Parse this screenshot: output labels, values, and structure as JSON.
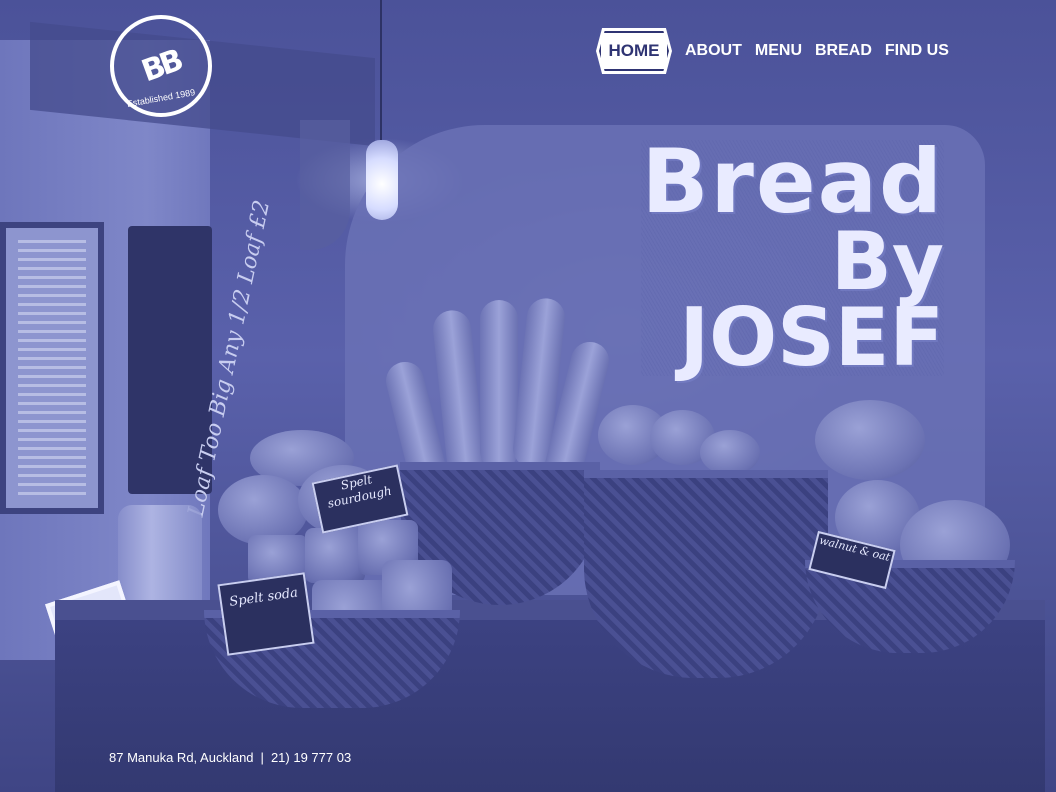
{
  "logo": {
    "mark": "BB",
    "ring_text": "Established 1989"
  },
  "nav": {
    "items": [
      {
        "label": "HOME"
      },
      {
        "label": "ABOUT"
      },
      {
        "label": "MENU"
      },
      {
        "label": "BREAD"
      },
      {
        "label": "FIND US"
      }
    ]
  },
  "hero": {
    "title_line1": "Bread",
    "title_line2": "By",
    "title_line3": "JOSEF",
    "signs": {
      "spelt_sourdough": "Spelt sourdough",
      "spelt_soda": "Spelt soda",
      "walnut": "walnut & oat"
    },
    "chalkboard_text": "Loaf Too Big Any 1/2 Loaf £2"
  },
  "footer": {
    "address": "87 Manuka Rd, Auckland",
    "separator": "|",
    "phone": "21) 19 777 03"
  },
  "colors": {
    "overlay": "#5159a6",
    "nav_home_bg": "#ffffff",
    "nav_home_text": "#2f3473",
    "text": "#ffffff"
  }
}
